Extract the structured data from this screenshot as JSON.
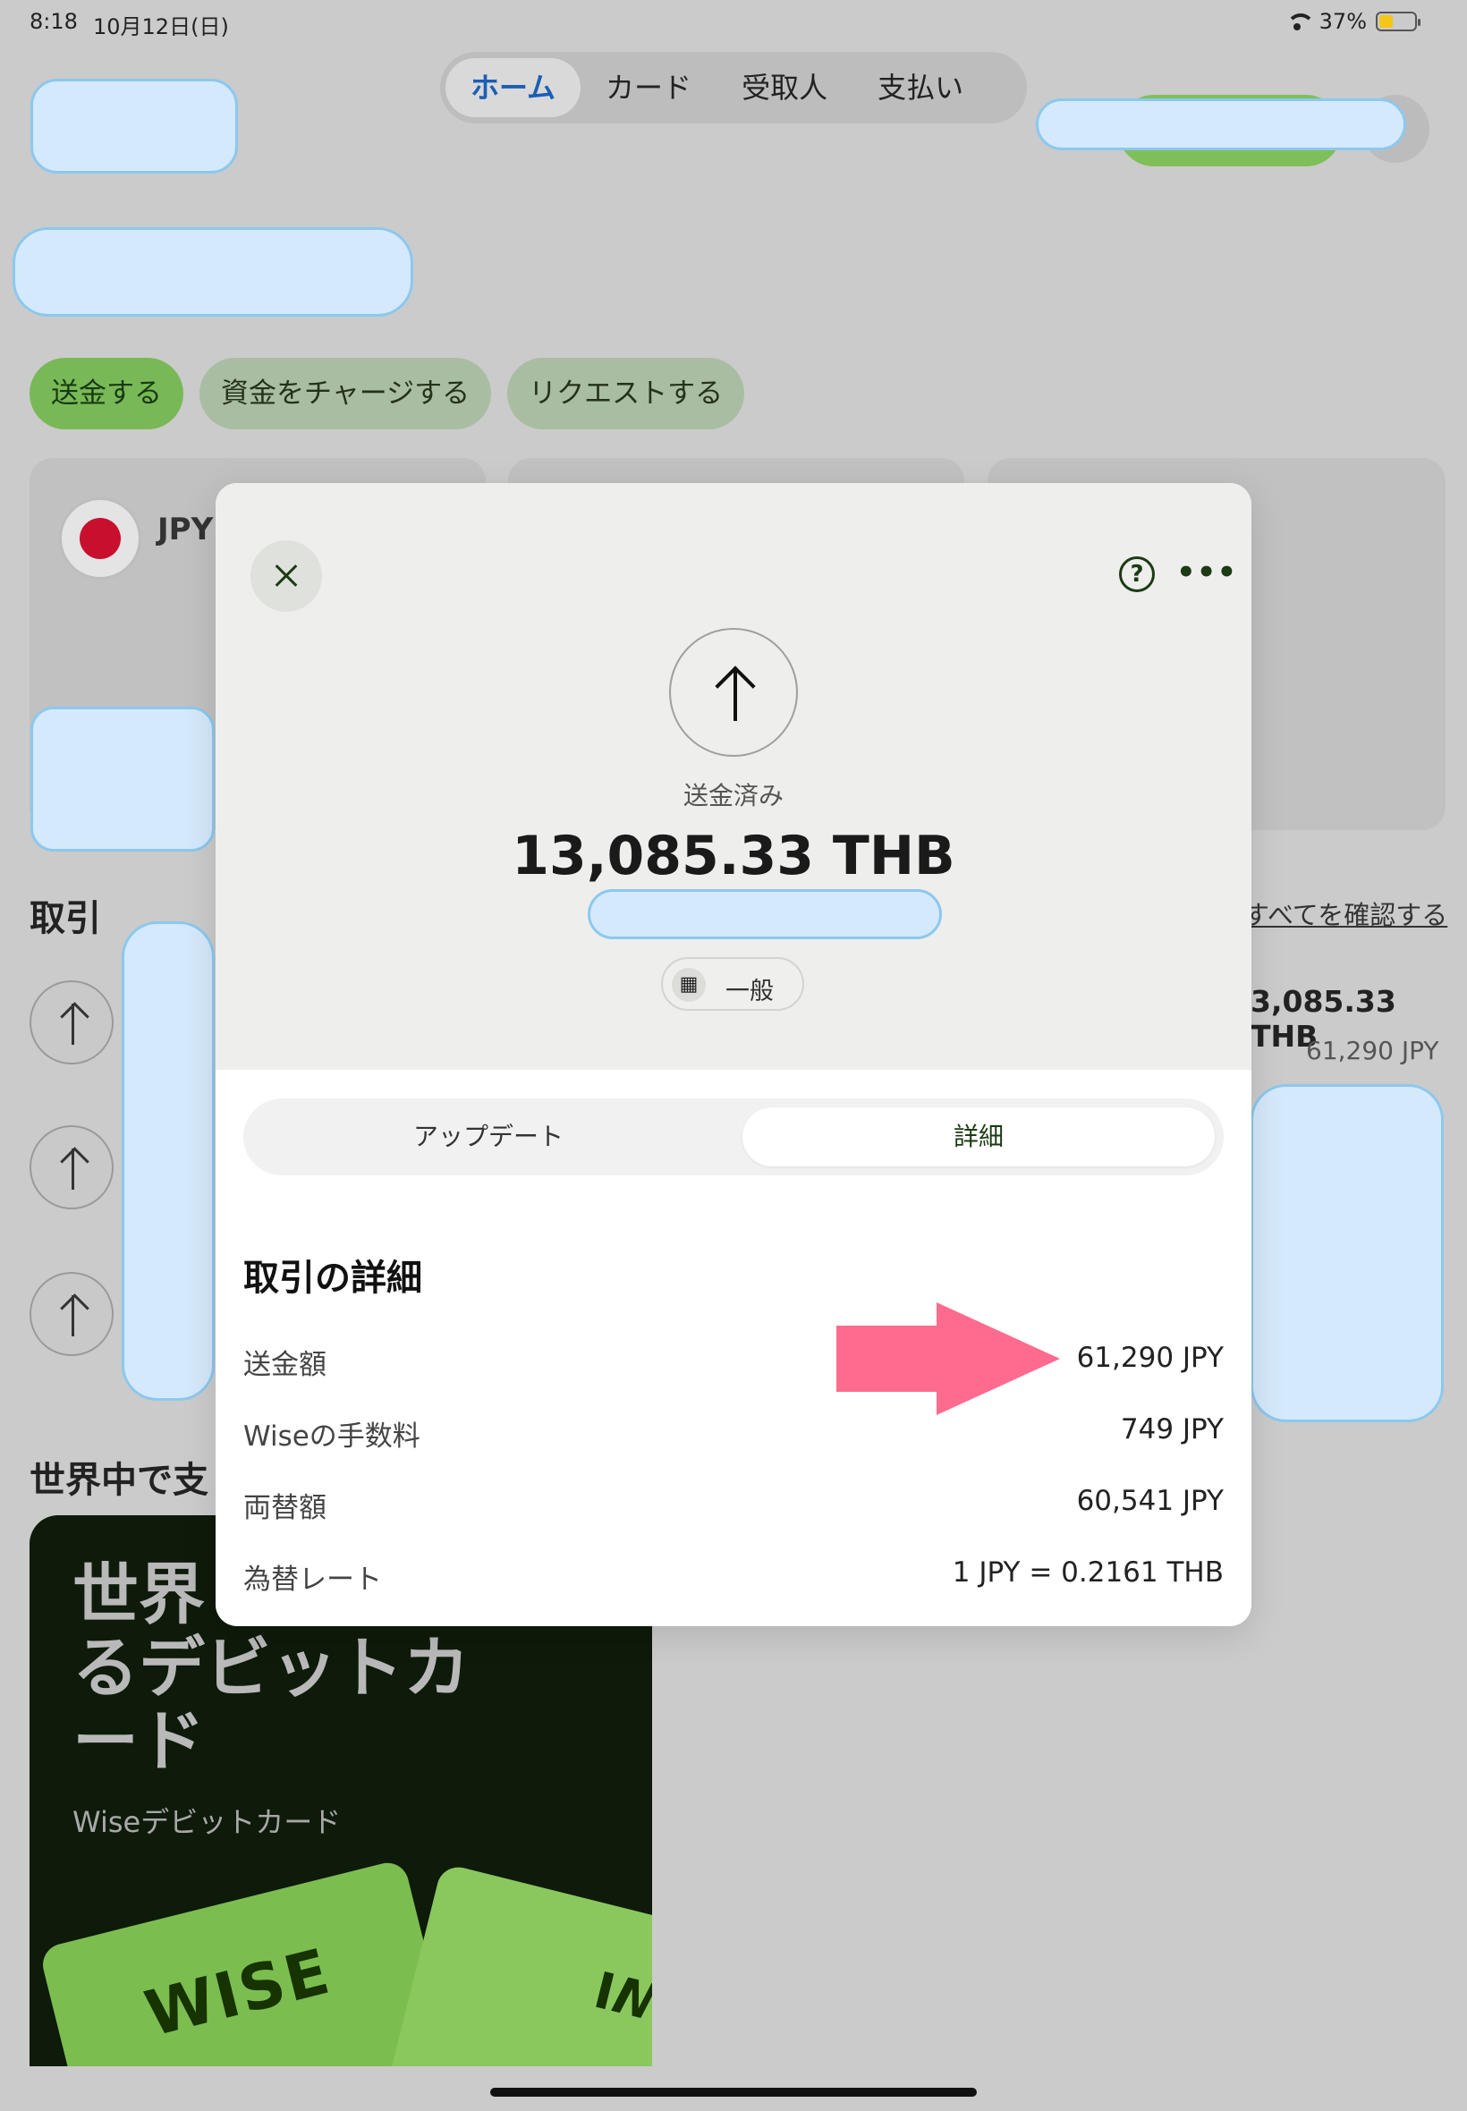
{
  "status_bar": {
    "time": "8:18",
    "date": "10月12日(日)",
    "battery": "37%"
  },
  "nav_tabs": [
    "ホーム",
    "カード",
    "受取人",
    "支払い"
  ],
  "actions": [
    "送金する",
    "資金をチャージする",
    "リクエストする"
  ],
  "balance_card": {
    "currency": "JPY"
  },
  "transactions": {
    "title": "取引",
    "see_all": "すべてを確認する",
    "first_amount": "3,085.33 THB",
    "first_sub": "61,290 JPY"
  },
  "world": {
    "title": "世界中で支"
  },
  "promo": {
    "headline": "世界中で使えるデビットカード",
    "headline_visible": "世界 \nるデビットカ\nード",
    "subtitle": "Wiseデビットカード",
    "card_brand": "WISE",
    "card_brand2": "WI"
  },
  "modal": {
    "status": "送金済み",
    "amount": "13,085.33 THB",
    "category": "一般",
    "tabs": [
      "アップデート",
      "詳細"
    ],
    "details_title": "取引の詳細",
    "rows": [
      {
        "label": "送金額",
        "value": "61,290 JPY"
      },
      {
        "label": "Wiseの手数料",
        "value": "749 JPY"
      },
      {
        "label": "両替額",
        "value": "60,541 JPY"
      },
      {
        "label": "為替レート",
        "value": "1 JPY = 0.2161 THB"
      }
    ],
    "help_symbol": "?",
    "more_symbol": "•••"
  },
  "colors": {
    "accent": "#1a5fb4",
    "brand_green": "#79b857",
    "arrow_pink": "#ff6b8f",
    "redaction": "#d4e9fb"
  }
}
